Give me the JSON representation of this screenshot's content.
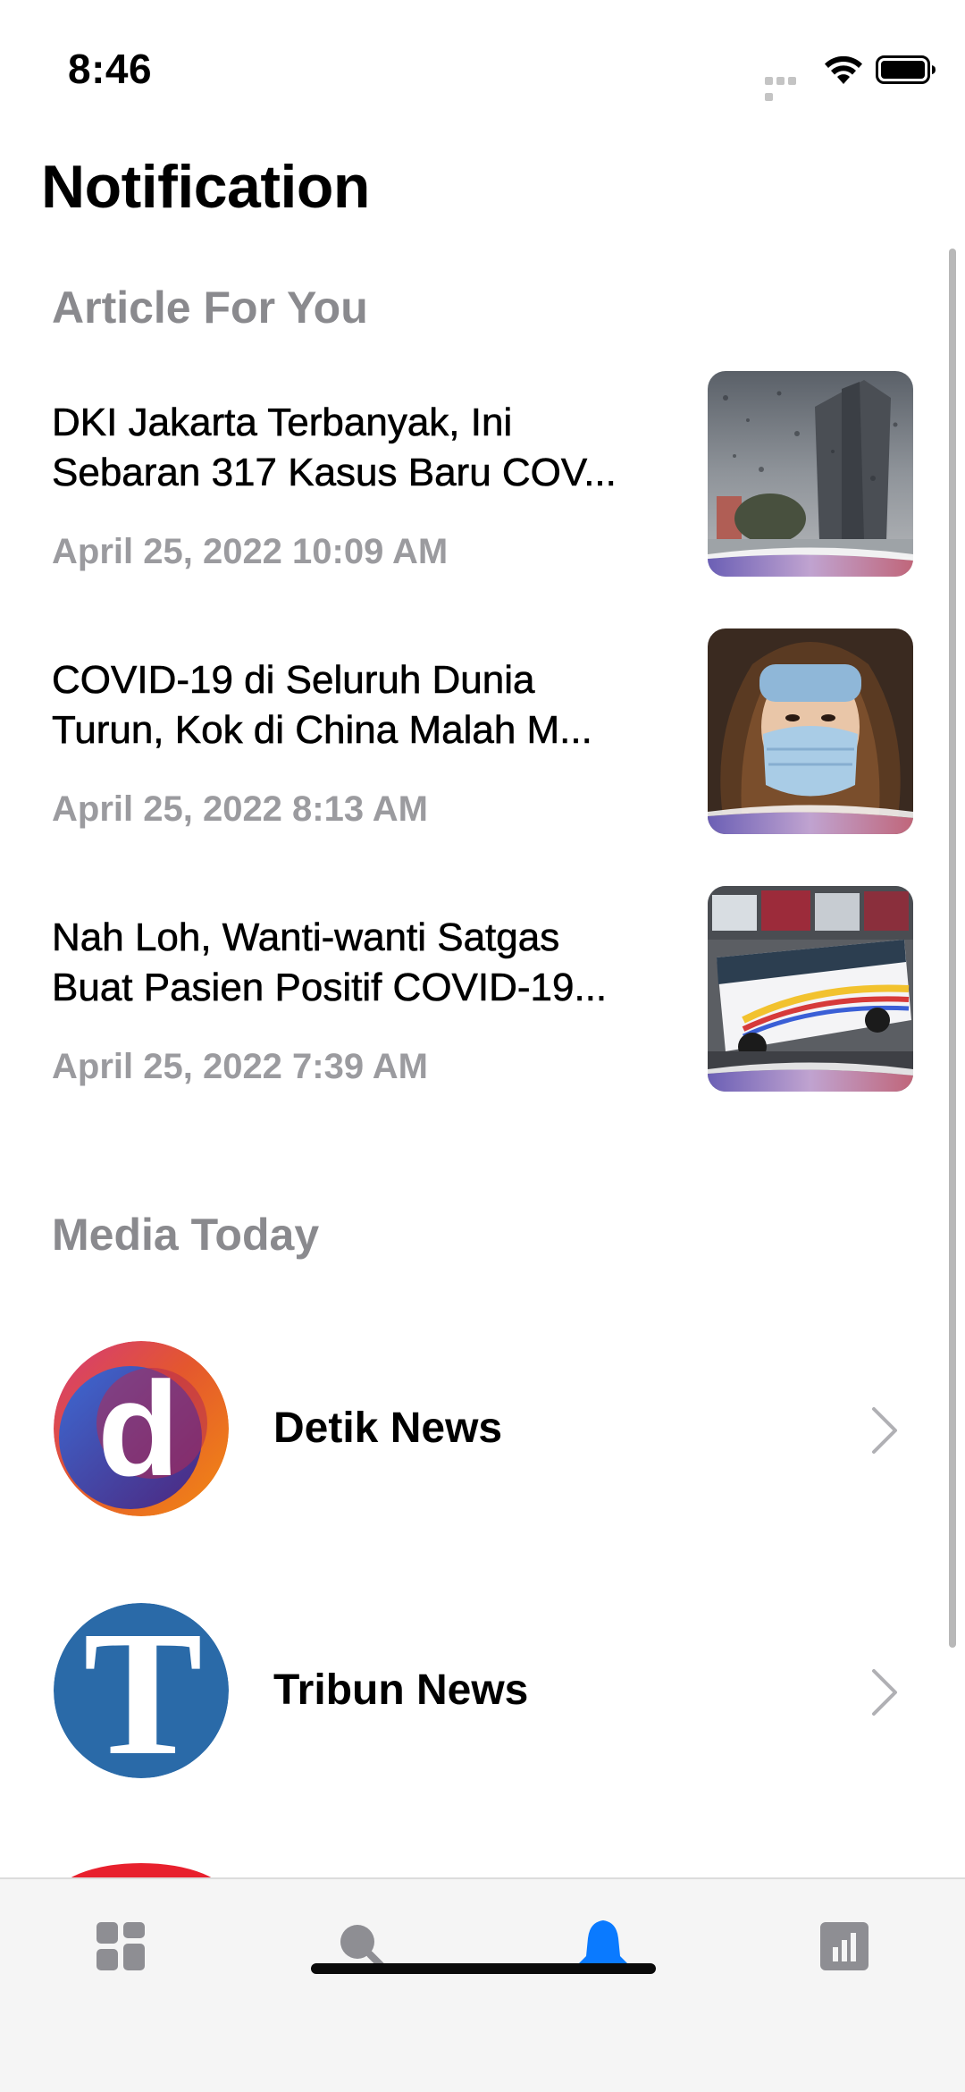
{
  "status_bar": {
    "time": "8:46"
  },
  "page": {
    "title": "Notification"
  },
  "sections": {
    "articles_header": "Article For You",
    "media_header": "Media Today"
  },
  "articles": [
    {
      "title_line1": "DKI Jakarta Terbanyak, Ini",
      "title_line2": "Sebaran 317 Kasus Baru COV...",
      "date": "April 25, 2022 10:09 AM",
      "thumbnail_icon": "rainy-city-photo"
    },
    {
      "title_line1": "COVID-19 di Seluruh Dunia",
      "title_line2": "Turun, Kok di China Malah M...",
      "date": "April 25, 2022 8:13 AM",
      "thumbnail_icon": "masked-woman-photo"
    },
    {
      "title_line1": "Nah Loh, Wanti-wanti Satgas",
      "title_line2": "Buat Pasien Positif COVID-19...",
      "date": "April 25, 2022 7:39 AM",
      "thumbnail_icon": "bus-terminal-photo"
    }
  ],
  "media": [
    {
      "name": "Detik News",
      "logo_icon": "detik-logo",
      "logo_letter": "d"
    },
    {
      "name": "Tribun News",
      "logo_icon": "tribun-logo",
      "logo_letter": "T"
    }
  ],
  "tab_bar": {
    "tabs": [
      {
        "icon": "dashboard-icon",
        "active": false
      },
      {
        "icon": "search-icon",
        "active": false
      },
      {
        "icon": "bell-icon",
        "active": true
      },
      {
        "icon": "chart-icon",
        "active": false
      }
    ]
  },
  "colors": {
    "accent": "#0a7aff",
    "inactive_tab": "#8e8e93",
    "secondary_text": "#8a8a8e",
    "tab_bar_bg": "#f5f5f5"
  }
}
